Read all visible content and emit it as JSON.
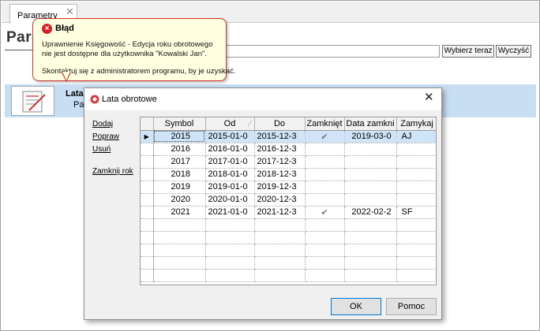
{
  "tab": {
    "label": "Parametry",
    "close_glyph": "✕"
  },
  "page": {
    "title": "Para",
    "buttons": {
      "wybierz": "Wybierz teraz",
      "wyczysc": "Wyczyść"
    },
    "row": {
      "title": "Lata",
      "subtitle": "Pa"
    }
  },
  "error_balloon": {
    "title": "Błąd",
    "icon_glyph": "×",
    "lines": [
      "Uprawnienie Księgowość - Edycja roku obrotowego",
      "nie jest dostępne dla użytkownika \"Kowalski Jan\".",
      "Skontaktuj się z administratorem programu, by je uzyskać."
    ]
  },
  "dialog": {
    "title": "Lata obrotowe",
    "close_glyph": "✕",
    "side_actions": [
      "Dodaj",
      "Popraw",
      "Usuń",
      "Zamknij rok"
    ],
    "columns": [
      "Symbol",
      "Od",
      "Do",
      "Zamknięt",
      "Data zamkni",
      "Zamykaj"
    ],
    "rows": [
      {
        "symbol": "2015",
        "od": "2015-01-0",
        "do": "2015-12-3",
        "zamkniety": "✔",
        "data_zamkniecia": "2019-03-0",
        "zamykajacy": "AJ",
        "current": true
      },
      {
        "symbol": "2016",
        "od": "2016-01-0",
        "do": "2016-12-3",
        "zamkniety": "",
        "data_zamkniecia": "",
        "zamykajacy": ""
      },
      {
        "symbol": "2017",
        "od": "2017-01-0",
        "do": "2017-12-3",
        "zamkniety": "",
        "data_zamkniecia": "",
        "zamykajacy": ""
      },
      {
        "symbol": "2018",
        "od": "2018-01-0",
        "do": "2018-12-3",
        "zamkniety": "",
        "data_zamkniecia": "",
        "zamykajacy": ""
      },
      {
        "symbol": "2019",
        "od": "2019-01-0",
        "do": "2019-12-3",
        "zamkniety": "",
        "data_zamkniecia": "",
        "zamykajacy": ""
      },
      {
        "symbol": "2020",
        "od": "2020-01-0",
        "do": "2020-12-3",
        "zamkniety": "",
        "data_zamkniecia": "",
        "zamykajacy": ""
      },
      {
        "symbol": "2021",
        "od": "2021-01-0",
        "do": "2021-12-3",
        "zamkniety": "✔",
        "data_zamkniecia": "2022-02-2",
        "zamykajacy": "SF"
      }
    ],
    "current_row_marker": "▶",
    "buttons": {
      "ok": "OK",
      "pomoc": "Pomoc"
    }
  },
  "colors": {
    "error": "#d82020",
    "balloon_bg": "#ffffe1",
    "selection": "#cfe4f7",
    "band": "#c8dff3"
  }
}
